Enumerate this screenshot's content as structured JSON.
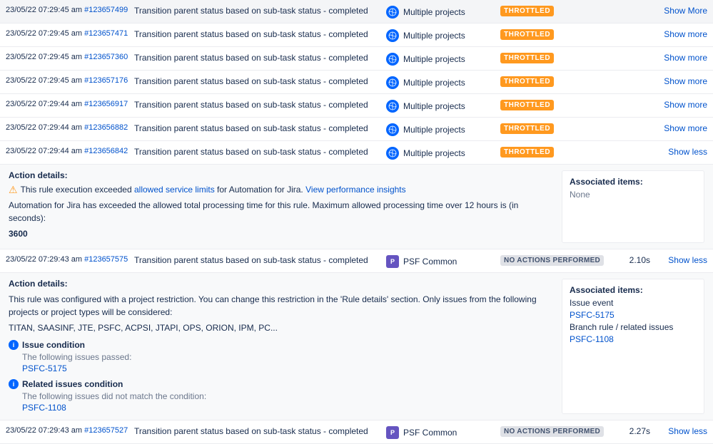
{
  "colors": {
    "throttled_bg": "#ff991f",
    "no_actions_bg": "#dfe1e6",
    "link": "#0052cc"
  },
  "rows": [
    {
      "timestamp": "23/05/22 07:29:45 am",
      "id": "#123657499",
      "description": "Transition parent status based on sub-task status - completed",
      "project_type": "globe",
      "project": "Multiple projects",
      "status": "THROTTLED",
      "time": "",
      "action": "Show More",
      "action_type": "show-more"
    },
    {
      "timestamp": "23/05/22 07:29:45 am",
      "id": "#123657471",
      "description": "Transition parent status based on sub-task status - completed",
      "project_type": "globe",
      "project": "Multiple projects",
      "status": "THROTTLED",
      "time": "",
      "action": "Show more",
      "action_type": "show-more"
    },
    {
      "timestamp": "23/05/22 07:29:45 am",
      "id": "#123657360",
      "description": "Transition parent status based on sub-task status - completed",
      "project_type": "globe",
      "project": "Multiple projects",
      "status": "THROTTLED",
      "time": "",
      "action": "Show more",
      "action_type": "show-more"
    },
    {
      "timestamp": "23/05/22 07:29:45 am",
      "id": "#123657176",
      "description": "Transition parent status based on sub-task status - completed",
      "project_type": "globe",
      "project": "Multiple projects",
      "status": "THROTTLED",
      "time": "",
      "action": "Show more",
      "action_type": "show-more"
    },
    {
      "timestamp": "23/05/22 07:29:44 am",
      "id": "#123656917",
      "description": "Transition parent status based on sub-task status - completed",
      "project_type": "globe",
      "project": "Multiple projects",
      "status": "THROTTLED",
      "time": "",
      "action": "Show more",
      "action_type": "show-more"
    },
    {
      "timestamp": "23/05/22 07:29:44 am",
      "id": "#123656882",
      "description": "Transition parent status based on sub-task status - completed",
      "project_type": "globe",
      "project": "Multiple projects",
      "status": "THROTTLED",
      "time": "",
      "action": "Show more",
      "action_type": "show-more"
    },
    {
      "timestamp": "23/05/22 07:29:44 am",
      "id": "#123656842",
      "description": "Transition parent status based on sub-task status - completed",
      "project_type": "globe",
      "project": "Multiple projects",
      "status": "THROTTLED",
      "time": "",
      "action": "Show less",
      "action_type": "show-less"
    }
  ],
  "detail_row_1": {
    "title": "Action details:",
    "warning": "This rule execution exceeded",
    "allowed_service_limits": "allowed service limits",
    "warning_suffix": "for Automation for Jira.",
    "perf_link": "View performance insights",
    "body": "Automation for Jira has exceeded the allowed total processing time for this rule. Maximum allowed processing time over 12 hours is (in seconds):",
    "number": "3600",
    "associated_title": "Associated items:",
    "associated_none": "None"
  },
  "row_psf_1": {
    "timestamp": "23/05/22 07:29:43 am",
    "id": "#123657575",
    "description": "Transition parent status based on sub-task status - completed",
    "project_type": "psf",
    "project": "PSF Common",
    "status": "NO ACTIONS PERFORMED",
    "time": "2.10s",
    "action": "Show less",
    "action_type": "show-less"
  },
  "detail_row_2": {
    "title": "Action details:",
    "body": "This rule was configured with a project restriction. You can change this restriction in the 'Rule details' section. Only issues from the following projects or project types will be considered:",
    "projects": "TITAN, SAASINF, JTE, PSFC, ACPSI, JTAPI, OPS, ORION, IPM, PC...",
    "associated_title": "Associated items:",
    "issue_event": "Issue event",
    "psfc_5175": "PSFC-5175",
    "branch_rule": "Branch rule / related issues",
    "psfc_1108": "PSFC-1108",
    "conditions": [
      {
        "icon": "info",
        "label": "Issue condition",
        "sub": "The following issues passed:",
        "issue": "PSFC-5175"
      },
      {
        "icon": "info",
        "label": "Related issues condition",
        "sub": "The following issues did not match the condition:",
        "issue": "PSFC-1108"
      }
    ]
  },
  "row_psf_2": {
    "timestamp": "23/05/22 07:29:43 am",
    "id": "#123657527",
    "description": "Transition parent status based on sub-task status - completed",
    "project_type": "psf",
    "project": "PSF Common",
    "status": "NO ACTIONS PERFORMED",
    "time": "2.27s",
    "action": "Show less",
    "action_type": "show-less"
  }
}
